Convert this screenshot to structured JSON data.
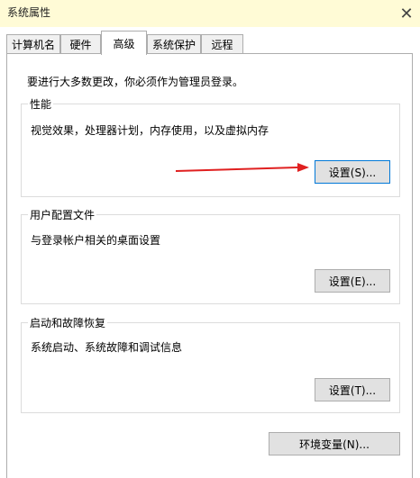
{
  "window": {
    "title": "系统属性"
  },
  "tabs": [
    {
      "label": "计算机名"
    },
    {
      "label": "硬件"
    },
    {
      "label": "高级"
    },
    {
      "label": "系统保护"
    },
    {
      "label": "远程"
    }
  ],
  "notice": "要进行大多数更改，你必须作为管理员登录。",
  "groups": {
    "performance": {
      "title": "性能",
      "description": "视觉效果，处理器计划，内存使用，以及虚拟内存",
      "button": "设置(S)..."
    },
    "user_profiles": {
      "title": "用户配置文件",
      "description": "与登录帐户相关的桌面设置",
      "button": "设置(E)..."
    },
    "startup_recovery": {
      "title": "启动和故障恢复",
      "description": "系统启动、系统故障和调试信息",
      "button": "设置(T)..."
    }
  },
  "env_button": "环境变量(N)...",
  "colors": {
    "titlebar": "#fffbd6",
    "arrow": "#e02020",
    "focus": "#0078d7"
  }
}
